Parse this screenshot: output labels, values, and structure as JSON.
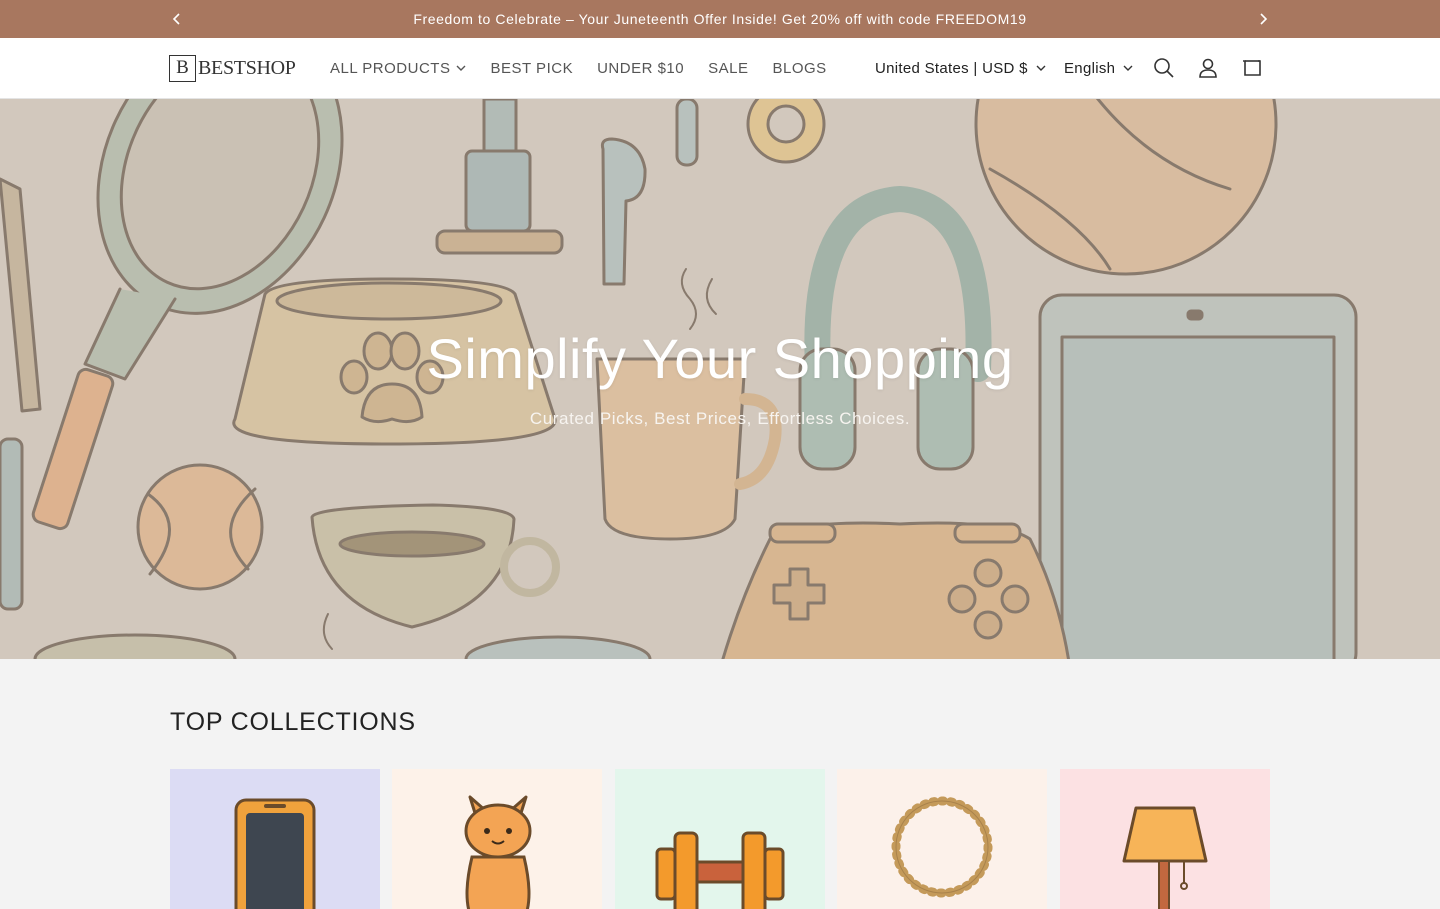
{
  "announcement": {
    "text": "Freedom to Celebrate – Your Juneteenth Offer Inside! Get 20% off with code FREEDOM19",
    "prev_icon": "chevron-left-icon",
    "next_icon": "chevron-right-icon"
  },
  "header": {
    "logo_mark": "B",
    "logo_text": "BESTSHOP",
    "nav": [
      {
        "label": "ALL PRODUCTS",
        "has_dropdown": true
      },
      {
        "label": "BEST PICK"
      },
      {
        "label": "UNDER $10"
      },
      {
        "label": "SALE"
      },
      {
        "label": "BLOGS"
      }
    ],
    "country_selector": "United States | USD $",
    "language_selector": "English",
    "icons": [
      "search-icon",
      "account-icon",
      "cart-icon"
    ]
  },
  "hero": {
    "title": "Simplify Your Shopping",
    "subtitle": "Curated Picks, Best Prices, Effortless Choices."
  },
  "collections": {
    "title": "TOP COLLECTIONS",
    "cards": [
      {
        "icon": "phone-icon",
        "bg": "#dcdcf4"
      },
      {
        "icon": "cat-icon",
        "bg": "#fdf2e9"
      },
      {
        "icon": "dumbbell-icon",
        "bg": "#e3f6ec"
      },
      {
        "icon": "necklace-icon",
        "bg": "#fcf1ea"
      },
      {
        "icon": "lamp-icon",
        "bg": "#fce1e3"
      }
    ]
  },
  "colors": {
    "announcement_bg": "#a8775f",
    "hero_bg": "#d2c9be"
  }
}
